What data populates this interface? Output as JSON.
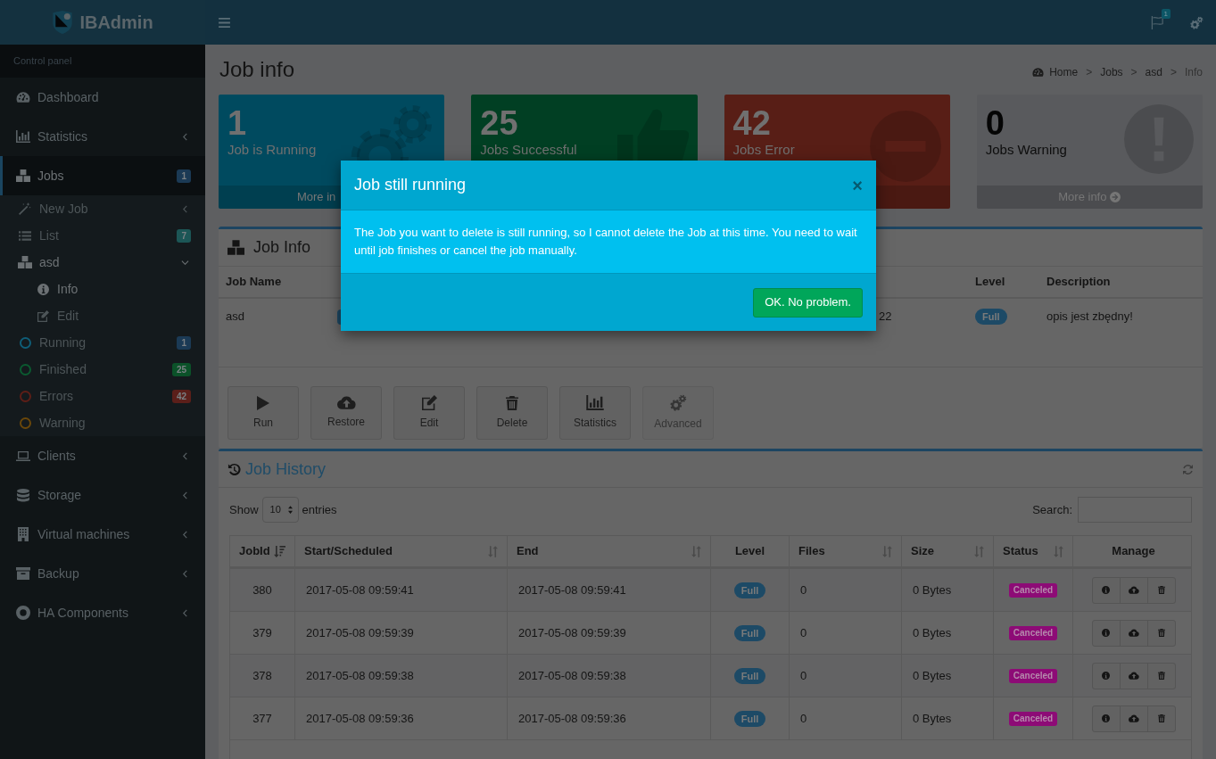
{
  "logo": {
    "text": "IBAdmin"
  },
  "navbar": {
    "notification_count": "1"
  },
  "sidebar": {
    "header": "Control panel",
    "items": [
      {
        "kind": "link",
        "label": "Dashboard",
        "selected": false
      },
      {
        "kind": "tree",
        "label": "Statistics",
        "selected": false,
        "expanded": false
      },
      {
        "kind": "tree",
        "label": "Jobs",
        "selected": true,
        "expanded": true,
        "badge": {
          "text": "1",
          "color": "#1b3a55"
        },
        "children": [
          {
            "kind": "tree",
            "label": "New Job",
            "selected": false,
            "expanded": false
          },
          {
            "kind": "link",
            "label": "List",
            "selected": false,
            "badge": {
              "text": "7",
              "color": "#1c5656"
            }
          },
          {
            "kind": "tree",
            "label": "asd",
            "selected": true,
            "expanded": true,
            "children": [
              {
                "kind": "link",
                "label": "Info",
                "selected": true
              },
              {
                "kind": "link",
                "label": "Edit",
                "selected": false
              }
            ]
          },
          {
            "kind": "status",
            "label": "Running",
            "selected": false,
            "color": "#0f5e78",
            "badge": {
              "text": "1",
              "color": "#1b3a55"
            }
          },
          {
            "kind": "status",
            "label": "Finished",
            "selected": false,
            "color": "#0b5a30",
            "badge": {
              "text": "25",
              "color": "#0b5229"
            }
          },
          {
            "kind": "status",
            "label": "Errors",
            "selected": false,
            "color": "#5e1e17",
            "badge": {
              "text": "42",
              "color": "#5b1f1a"
            }
          },
          {
            "kind": "status",
            "label": "Warning",
            "selected": false,
            "color": "#6a470a"
          }
        ]
      },
      {
        "kind": "tree",
        "label": "Clients",
        "selected": false,
        "expanded": false
      },
      {
        "kind": "tree",
        "label": "Storage",
        "selected": false,
        "expanded": false
      },
      {
        "kind": "tree",
        "label": "Virtual machines",
        "selected": false,
        "expanded": false
      },
      {
        "kind": "tree",
        "label": "Backup",
        "selected": false,
        "expanded": false
      },
      {
        "kind": "tree",
        "label": "HA Components",
        "selected": false,
        "expanded": false
      }
    ]
  },
  "page": {
    "title": "Job info",
    "breadcrumb": [
      {
        "kind": "link",
        "label": "Home"
      },
      {
        "kind": "separator",
        "label": ">"
      },
      {
        "kind": "link",
        "label": "Jobs"
      },
      {
        "kind": "separator",
        "label": ">"
      },
      {
        "kind": "link",
        "label": "asd"
      },
      {
        "kind": "separator",
        "label": ">"
      },
      {
        "kind": "current",
        "label": "Info"
      }
    ]
  },
  "stat_boxes": [
    {
      "value": "1",
      "label": "Job is Running",
      "footer": "More in",
      "footer_arrow": false,
      "color": "#004a5f"
    },
    {
      "value": "25",
      "label": "Jobs Successful",
      "color": "#013f23"
    },
    {
      "value": "42",
      "label": "Jobs Error",
      "footer_strip": true,
      "color": "#581e16"
    },
    {
      "value": "0",
      "label": "Jobs Warning",
      "footer": "More info",
      "footer_arrow": true,
      "color": "#595a5d"
    }
  ],
  "job_info": {
    "title": "Job Info",
    "columns": {
      "job_name": "Job Name",
      "level": "Level",
      "description": "Description"
    },
    "row": {
      "job_name": "asd",
      "column_3": "22",
      "level": "Full",
      "description": "opis jest zbędny!"
    },
    "actions": [
      {
        "label": "Run",
        "disabled": false
      },
      {
        "label": "Restore",
        "disabled": false
      },
      {
        "label": "Edit",
        "disabled": false
      },
      {
        "label": "Delete",
        "disabled": false
      },
      {
        "label": "Statistics",
        "disabled": false
      },
      {
        "label": "Advanced",
        "disabled": true
      }
    ]
  },
  "job_history": {
    "title": "Job History",
    "show_label": "Show",
    "page_size": "10",
    "entries_label": "entries",
    "search_label": "Search:",
    "columns": [
      {
        "label": "JobId",
        "sortable": true,
        "sorted": true
      },
      {
        "label": "Start/Scheduled",
        "sortable": true,
        "sorted": false
      },
      {
        "label": "End",
        "sortable": true,
        "sorted": false
      },
      {
        "label": "Level",
        "sortable": false,
        "sorted": false
      },
      {
        "label": "Files",
        "sortable": true,
        "sorted": false
      },
      {
        "label": "Size",
        "sortable": true,
        "sorted": false
      },
      {
        "label": "Status",
        "sortable": true,
        "sorted": false
      },
      {
        "label": "Manage",
        "sortable": false,
        "sorted": false
      }
    ],
    "rows": [
      {
        "job_id": "380",
        "start": "2017-05-08 09:59:41",
        "end": "2017-05-08 09:59:41",
        "level": "Full",
        "files": "0",
        "size": "0 Bytes",
        "status": "Canceled"
      },
      {
        "job_id": "379",
        "start": "2017-05-08 09:59:39",
        "end": "2017-05-08 09:59:39",
        "level": "Full",
        "files": "0",
        "size": "0 Bytes",
        "status": "Canceled"
      },
      {
        "job_id": "378",
        "start": "2017-05-08 09:59:38",
        "end": "2017-05-08 09:59:38",
        "level": "Full",
        "files": "0",
        "size": "0 Bytes",
        "status": "Canceled"
      },
      {
        "job_id": "377",
        "start": "2017-05-08 09:59:36",
        "end": "2017-05-08 09:59:36",
        "level": "Full",
        "files": "0",
        "size": "0 Bytes",
        "status": "Canceled"
      }
    ]
  },
  "modal": {
    "title": "Job still running",
    "close": "×",
    "message": "The Job you want to delete is still running, so I cannot delete the Job at this time. You need to wait until job finishes or cancel the job manually.",
    "button": "OK. No problem."
  }
}
